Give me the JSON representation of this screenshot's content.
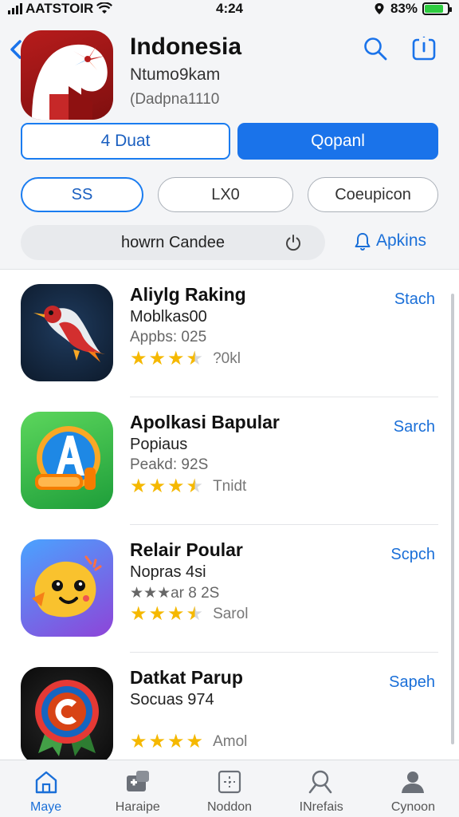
{
  "status": {
    "carrier": "AATSTOIR",
    "time": "4:24",
    "battery": "83%",
    "battery_level": 0.83
  },
  "header": {
    "app_title": "Indonesia",
    "app_subtitle": "Ntumo9kam",
    "app_developer": "(Dadpna1110",
    "btn_outline": "4 Duat",
    "btn_solid": "Qopanl",
    "filters": [
      "SS",
      "LX0",
      "Coeupicon"
    ],
    "search_text": "howrn Candee",
    "apps_link": "Apkins"
  },
  "apps": [
    {
      "name": "Aliylg Raking",
      "category": "Moblkas00",
      "meta": "Appbs: 025",
      "rating_label": "?0kl",
      "stars": 3.5,
      "action": "Stach",
      "icon": "bird-icon"
    },
    {
      "name": "Apolkasi Bapular",
      "category": "Popiaus",
      "meta": "Peakd: 92S",
      "rating_label": "Tnidt",
      "stars": 3.5,
      "action": "Sarch",
      "icon": "letter-a-icon"
    },
    {
      "name": "Relair Poular",
      "category": "Nopras 4si",
      "meta": "★★★ar 8 2S",
      "rating_label": "Sarol",
      "stars": 3.5,
      "action": "Scpch",
      "icon": "smiley-face-icon"
    },
    {
      "name": "Datkat Parup",
      "category": "Socuas 974",
      "meta": "",
      "rating_label": "Amol",
      "stars": 4,
      "action": "Sapeh",
      "icon": "letter-c-badge-icon"
    }
  ],
  "tabs": [
    {
      "label": "Maye",
      "icon": "home-icon",
      "active": true
    },
    {
      "label": "Haraipe",
      "icon": "games-icon",
      "active": false
    },
    {
      "label": "Noddon",
      "icon": "apps-icon",
      "active": false
    },
    {
      "label": "INrefais",
      "icon": "search-icon",
      "active": false
    },
    {
      "label": "Cynoon",
      "icon": "profile-icon",
      "active": false
    }
  ],
  "colors": {
    "accent": "#1a73ea",
    "star": "#f5b800",
    "background": "#f4f5f7"
  }
}
